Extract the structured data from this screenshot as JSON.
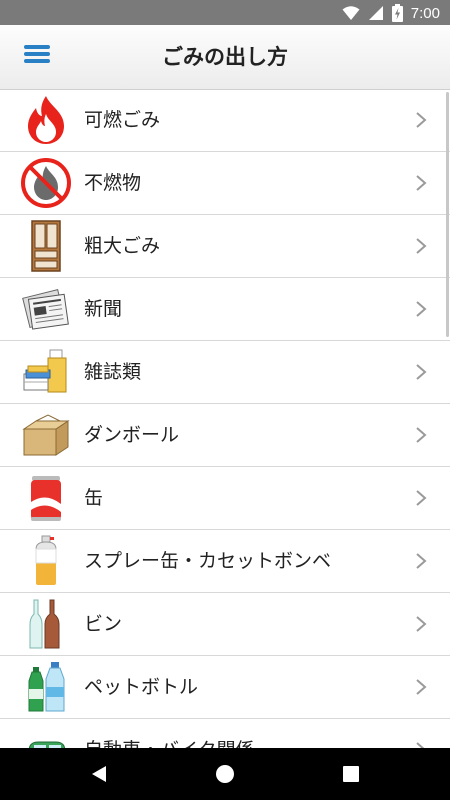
{
  "status_bar": {
    "time": "7:00"
  },
  "header": {
    "title": "ごみの出し方",
    "menu_icon": "hamburger-menu-icon"
  },
  "colors": {
    "accent": "#2a80c4",
    "status_bar": "#7a7a7a"
  },
  "items": [
    {
      "label": "可燃ごみ",
      "icon": "fire-icon"
    },
    {
      "label": "不燃物",
      "icon": "no-burn-icon"
    },
    {
      "label": "粗大ごみ",
      "icon": "cabinet-icon"
    },
    {
      "label": "新聞",
      "icon": "newspaper-icon"
    },
    {
      "label": "雑誌類",
      "icon": "magazines-icon"
    },
    {
      "label": "ダンボール",
      "icon": "cardboard-box-icon"
    },
    {
      "label": "缶",
      "icon": "can-icon"
    },
    {
      "label": "スプレー缶・カセットボンベ",
      "icon": "spray-can-icon"
    },
    {
      "label": "ビン",
      "icon": "bottles-icon"
    },
    {
      "label": "ペットボトル",
      "icon": "pet-bottles-icon"
    },
    {
      "label": "自動車・バイク関係",
      "icon": "car-icon"
    }
  ]
}
